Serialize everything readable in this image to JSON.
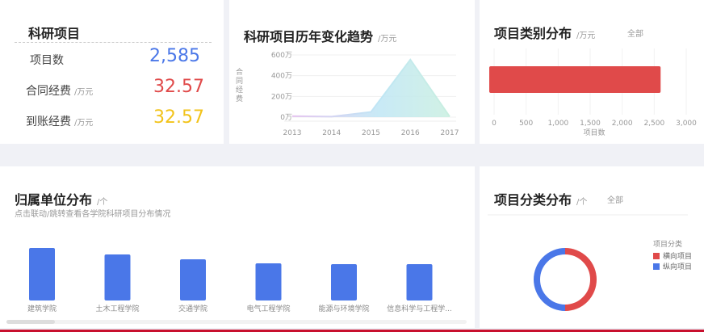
{
  "summary": {
    "title": "科研项目",
    "rows": [
      {
        "label": "项目数",
        "unit": "",
        "value": "2,585",
        "color": "#4a77e8"
      },
      {
        "label": "合同经费",
        "unit": "/万元",
        "value": "32.57",
        "color": "#e04a4a"
      },
      {
        "label": "到账经费",
        "unit": "/万元",
        "value": "32.57",
        "color": "#f2c31a"
      }
    ]
  },
  "trend": {
    "title": "科研项目历年变化趋势",
    "unit": "/万元",
    "chart_data": {
      "type": "area",
      "x": [
        "2013",
        "2014",
        "2015",
        "2016",
        "2017"
      ],
      "series": [
        {
          "name": "",
          "values": [
            10,
            5,
            50,
            555,
            5
          ]
        }
      ],
      "ylabel": "合同经费",
      "ylim": [
        0,
        600
      ],
      "yticks": [
        "0万",
        "200万",
        "400万",
        "600万"
      ],
      "ytick_values": [
        0,
        200,
        400,
        600
      ]
    }
  },
  "category": {
    "title": "项目类别分布",
    "unit": "/万元",
    "filter": "全部",
    "chart_data": {
      "type": "bar",
      "orientation": "horizontal",
      "categories": [
        ""
      ],
      "values": [
        2600
      ],
      "xlabel": "项目数",
      "xlim": [
        0,
        3000
      ],
      "xticks": [
        "0",
        "500",
        "1,000",
        "1,500",
        "2,000",
        "2,500",
        "3,000"
      ],
      "xtick_values": [
        0,
        500,
        1000,
        1500,
        2000,
        2500,
        3000
      ],
      "color": "#e04a4a"
    }
  },
  "units": {
    "title": "归属单位分布",
    "unit": "/个",
    "subtitle": "点击联动/跳转查看各学院科研项目分布情况",
    "chart_data": {
      "type": "bar",
      "categories": [
        "建筑学院",
        "土木工程学院",
        "交通学院",
        "电气工程学院",
        "能源与环境学院",
        "信息科学与工程学..."
      ],
      "values": [
        65,
        57,
        51,
        46,
        45,
        45
      ],
      "ylim": [
        0,
        70
      ],
      "color": "#4a77e8"
    }
  },
  "classdist": {
    "title": "项目分类分布",
    "unit": "/个",
    "filter": "全部",
    "chart_data": {
      "type": "pie",
      "legend_title": "项目分类",
      "legend_position": "right",
      "labels": [
        "横向项目",
        "纵向项目"
      ],
      "values": [
        50,
        50
      ],
      "colors": [
        "#e04a4a",
        "#4a77e8"
      ]
    }
  }
}
